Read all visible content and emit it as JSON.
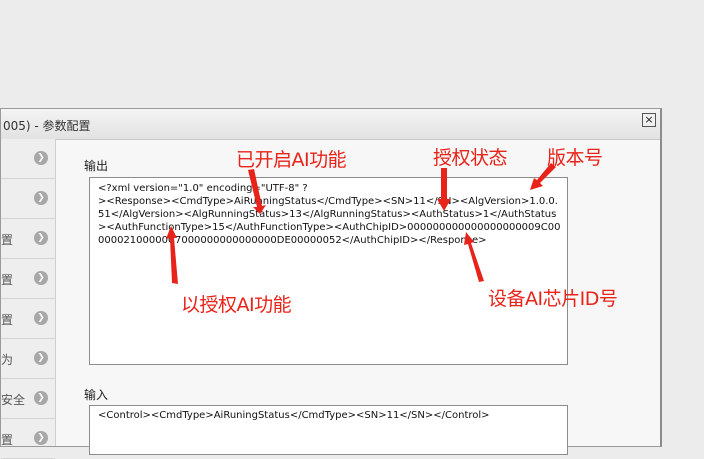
{
  "window": {
    "title": "005) - 参数配置",
    "close_label": "×"
  },
  "sidebar": {
    "items": [
      {
        "label": "",
        "icon": "chevron-right-icon"
      },
      {
        "label": "",
        "icon": "chevron-right-icon"
      },
      {
        "label": "置",
        "icon": "chevron-right-icon"
      },
      {
        "label": "置",
        "icon": "chevron-right-icon"
      },
      {
        "label": "置",
        "icon": "chevron-right-icon"
      },
      {
        "label": "为",
        "icon": "chevron-right-icon"
      },
      {
        "label": "安全",
        "icon": "chevron-right-icon"
      },
      {
        "label": "置",
        "icon": "chevron-right-icon"
      }
    ]
  },
  "output": {
    "label": "输出",
    "text": "<?xml version=\"1.0\" encoding=\"UTF-8\" ?\n><Response><CmdType>AiRunningStatus</CmdType><SN>11</SN><AlgVersion>1.0.0.51</AlgVersion><AlgRunningStatus>13</AlgRunningStatus><AuthStatus>1</AuthStatus><AuthFunctionType>15</AuthFunctionType><AuthChipID>000000000000000000009C0000002100000C7000000000000000DE00000052</AuthChipID></Response>"
  },
  "input": {
    "label": "输入",
    "text": "<Control><CmdType>AiRuningStatus</CmdType><SN>11</SN></Control>"
  },
  "annotations": {
    "alg_running": "已开启AI功能",
    "auth_status": "授权状态",
    "version": "版本号",
    "auth_function": "以授权AI功能",
    "chip_id": "设备AI芯片ID号"
  },
  "colors": {
    "annotation": "#e8231a"
  }
}
